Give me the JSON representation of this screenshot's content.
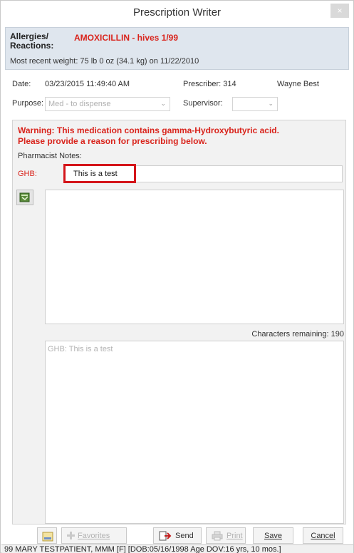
{
  "window": {
    "title": "Prescription Writer",
    "close_label": "×"
  },
  "patient": {
    "allergies_label_1": "Allergies/",
    "allergies_label_2": "Reactions:",
    "allergies_value": "AMOXICILLIN  - hives 1/99",
    "weight_text": "Most recent weight:   75 lb 0 oz (34.1 kg) on 11/22/2010"
  },
  "rx": {
    "date_label": "Date:",
    "date_value": "03/23/2015 11:49:40 AM",
    "prescriber_text": "Prescriber: 314",
    "prescriber_name": "Wayne Best",
    "purpose_label": "Purpose:",
    "purpose_value": "Med - to dispense",
    "supervisor_label": "Supervisor:",
    "supervisor_value": ""
  },
  "warning": {
    "line1": "Warning: This medication contains gamma-Hydroxybutyric acid.",
    "line2": "Please provide a reason for prescribing below."
  },
  "notes": {
    "label": "Pharmacist Notes:",
    "ghb_label": "GHB:",
    "ghb_value": "This is a test",
    "chars_remaining": "Characters remaining: 190",
    "preview": "GHB: This is a test"
  },
  "buttons": {
    "favorites": "Favorites",
    "send": "Send",
    "print": "Print",
    "save": "Save",
    "cancel": "Cancel"
  },
  "status": {
    "text": "99 MARY TESTPATIENT, MMM [F] [DOB:05/16/1998  Age DOV:16 yrs, 10 mos.]"
  },
  "colors": {
    "warning_red": "#d9241c",
    "highlight_red": "#d4151a",
    "header_band": "#dfe6ee"
  }
}
